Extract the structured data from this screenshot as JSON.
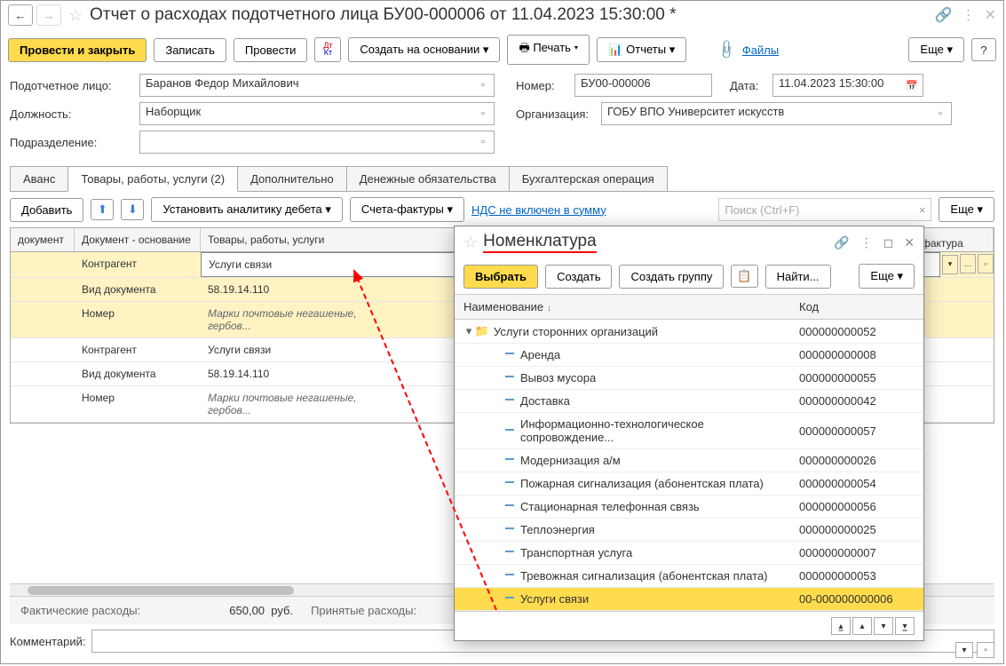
{
  "header": {
    "title": "Отчет о расходах подотчетного лица БУ00-000006 от 11.04.2023 15:30:00 *"
  },
  "toolbar": {
    "submit_close": "Провести и закрыть",
    "save": "Записать",
    "submit": "Провести",
    "create_based": "Создать на основании",
    "print": "Печать",
    "reports": "Отчеты",
    "files": "Файлы",
    "more": "Еще",
    "help": "?"
  },
  "form": {
    "person_label": "Подотчетное лицо:",
    "person_value": "Баранов Федор Михайлович",
    "number_label": "Номер:",
    "number_value": "БУ00-000006",
    "date_label": "Дата:",
    "date_value": "11.04.2023 15:30:00",
    "position_label": "Должность:",
    "position_value": "Наборщик",
    "org_label": "Организация:",
    "org_value": "ГОБУ ВПО Университет искусств",
    "dept_label": "Подразделение:",
    "dept_value": ""
  },
  "tabs": {
    "advance": "Аванс",
    "goods": "Товары, работы, услуги (2)",
    "additional": "Дополнительно",
    "money": "Денежные обязательства",
    "accounting": "Бухгалтерская операция"
  },
  "sub_toolbar": {
    "add": "Добавить",
    "set_debit": "Установить аналитику дебета",
    "invoices": "Счета-фактуры",
    "vat_link": "НДС не включен в сумму",
    "search_placeholder": "Поиск (Ctrl+F)",
    "more": "Еще"
  },
  "table": {
    "headers": {
      "document": "документ",
      "basis": "Документ - основание",
      "goods": "Товары, работы, услуги",
      "invoice": "фактура"
    },
    "rows": [
      {
        "highlighted": true,
        "basis": "Контрагент",
        "goods": "Услуги связи",
        "editing": true
      },
      {
        "highlighted": true,
        "basis": "Вид документа",
        "goods": "58.19.14.110"
      },
      {
        "highlighted": true,
        "basis": "Номер",
        "goods_italic": "Марки почтовые негашеные, гербов..."
      },
      {
        "basis": "Контрагент",
        "goods": "Услуги связи"
      },
      {
        "basis": "Вид документа",
        "goods": "58.19.14.110"
      },
      {
        "basis": "Номер",
        "goods_italic": "Марки почтовые негашеные, гербов..."
      }
    ]
  },
  "bottom": {
    "actual_label": "Фактические расходы:",
    "actual_value": "650,00",
    "currency": "руб.",
    "accepted_label": "Принятые расходы:",
    "comment_label": "Комментарий:"
  },
  "popup": {
    "title": "Номенклатура",
    "select": "Выбрать",
    "create": "Создать",
    "create_group": "Создать группу",
    "find": "Найти...",
    "more": "Еще",
    "th_name": "Наименование",
    "th_code": "Код",
    "folder": {
      "name": "Услуги сторонних организаций",
      "code": "000000000052"
    },
    "items": [
      {
        "name": "Аренда",
        "code": "000000000008"
      },
      {
        "name": "Вывоз мусора",
        "code": "000000000055"
      },
      {
        "name": "Доставка",
        "code": "000000000042"
      },
      {
        "name": "Информационно-технологическое сопровождение...",
        "code": "000000000057"
      },
      {
        "name": "Модернизация а/м",
        "code": "000000000026"
      },
      {
        "name": "Пожарная сигнализация (абонентская плата)",
        "code": "000000000054"
      },
      {
        "name": "Стационарная телефонная связь",
        "code": "000000000056"
      },
      {
        "name": "Теплоэнергия",
        "code": "000000000025"
      },
      {
        "name": "Транспортная услуга",
        "code": "000000000007"
      },
      {
        "name": "Тревожная сигнализация (абонентская плата)",
        "code": "000000000053"
      },
      {
        "name": "Услуги связи",
        "code": "00-000000000006",
        "selected": true
      }
    ]
  }
}
